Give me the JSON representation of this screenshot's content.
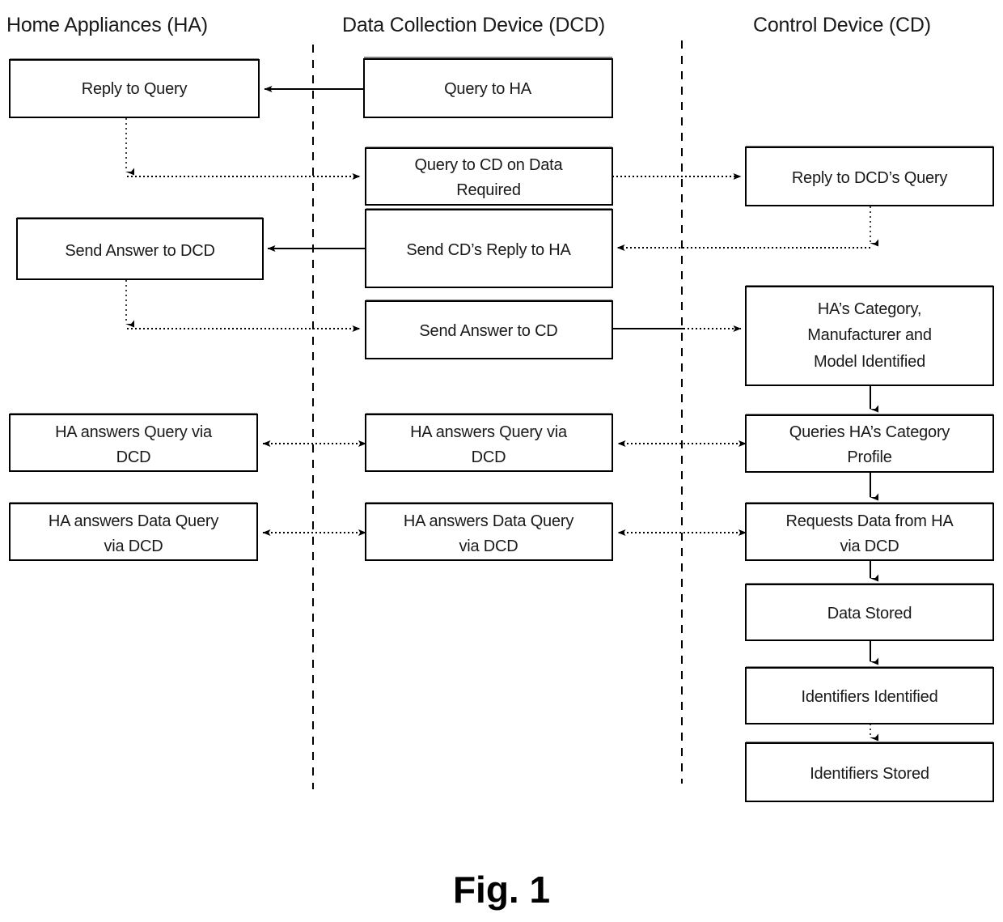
{
  "figure": {
    "caption": "Fig. 1",
    "lanes": [
      {
        "id": "ha",
        "title": "Home Appliances (HA)"
      },
      {
        "id": "dcd",
        "title": "Data Collection Device (DCD)"
      },
      {
        "id": "cd",
        "title": "Control Device (CD)"
      }
    ],
    "nodes": {
      "ha_reply_to_query": "Reply to Query",
      "ha_send_answer_to_dcd": "Send Answer to DCD",
      "ha_answers_query_line1": "HA answers Query via",
      "ha_answers_query_line2": "DCD",
      "ha_answers_data_query_line1": "HA answers Data Query",
      "ha_answers_data_query_line2": "via DCD",
      "dcd_query_to_ha": "Query to HA",
      "dcd_query_to_cd_line1": "Query to CD on Data",
      "dcd_query_to_cd_line2": "Required",
      "dcd_send_cds_reply": "Send CD’s Reply to HA",
      "dcd_send_answer_to_cd": "Send Answer to CD",
      "dcd_answers_query_line1": "HA answers Query via",
      "dcd_answers_query_line2": "DCD",
      "dcd_answers_data_query_line1": "HA answers Data Query",
      "dcd_answers_data_query_line2": "via DCD",
      "cd_reply_to_dcd_query": "Reply to DCD’s Query",
      "cd_category_line1": "HA’s Category,",
      "cd_category_line2": "Manufacturer and",
      "cd_category_line3": "Model Identified",
      "cd_queries_profile_line1": "Queries HA’s Category",
      "cd_queries_profile_line2": "Profile",
      "cd_requests_data_line1": "Requests Data from HA",
      "cd_requests_data_line2": "via DCD",
      "cd_data_stored": "Data Stored",
      "cd_identifiers_identified": "Identifiers Identified",
      "cd_identifiers_stored": "Identifiers Stored"
    },
    "colors": {
      "background": "#ffffff",
      "stroke": "#000000",
      "text": "#1a1a1a",
      "box_fill": "#ffffff",
      "box_shadow": "#808080"
    }
  },
  "chart_data": {
    "type": "diagram",
    "title": "Fig. 1",
    "subtype": "swimlane-flowchart",
    "lanes": [
      "Home Appliances (HA)",
      "Data Collection Device (DCD)",
      "Control Device (CD)"
    ],
    "nodes": [
      {
        "lane": "Home Appliances (HA)",
        "label": "Reply to Query"
      },
      {
        "lane": "Home Appliances (HA)",
        "label": "Send Answer to DCD"
      },
      {
        "lane": "Home Appliances (HA)",
        "label": "HA answers Query via DCD"
      },
      {
        "lane": "Home Appliances (HA)",
        "label": "HA answers Data Query via DCD"
      },
      {
        "lane": "Data Collection Device (DCD)",
        "label": "Query to HA"
      },
      {
        "lane": "Data Collection Device (DCD)",
        "label": "Query to CD on Data Required"
      },
      {
        "lane": "Data Collection Device (DCD)",
        "label": "Send CD’s Reply to HA"
      },
      {
        "lane": "Data Collection Device (DCD)",
        "label": "Send Answer to CD"
      },
      {
        "lane": "Data Collection Device (DCD)",
        "label": "HA answers Query via DCD"
      },
      {
        "lane": "Data Collection Device (DCD)",
        "label": "HA answers Data Query via DCD"
      },
      {
        "lane": "Control Device (CD)",
        "label": "Reply to DCD’s Query"
      },
      {
        "lane": "Control Device (CD)",
        "label": "HA’s Category, Manufacturer and Model Identified"
      },
      {
        "lane": "Control Device (CD)",
        "label": "Queries HA’s Category Profile"
      },
      {
        "lane": "Control Device (CD)",
        "label": "Requests Data from HA via DCD"
      },
      {
        "lane": "Control Device (CD)",
        "label": "Data Stored"
      },
      {
        "lane": "Control Device (CD)",
        "label": "Identifiers Identified"
      },
      {
        "lane": "Control Device (CD)",
        "label": "Identifiers Stored"
      }
    ],
    "edges": [
      {
        "from": "Query to HA",
        "to": "Reply to Query",
        "style": "solid",
        "direction": "one-way"
      },
      {
        "from": "Reply to Query",
        "to": "Query to CD on Data Required",
        "style": "dotted",
        "direction": "one-way"
      },
      {
        "from": "Query to CD on Data Required",
        "to": "Reply to DCD’s Query",
        "style": "dotted",
        "direction": "one-way"
      },
      {
        "from": "Reply to DCD’s Query",
        "to": "Send CD’s Reply to HA",
        "style": "dotted",
        "direction": "one-way"
      },
      {
        "from": "Send CD’s Reply to HA",
        "to": "Send Answer to DCD",
        "style": "solid",
        "direction": "one-way"
      },
      {
        "from": "Send Answer to DCD",
        "to": "Send Answer to CD",
        "style": "dotted",
        "direction": "one-way"
      },
      {
        "from": "Send Answer to CD",
        "to": "HA’s Category, Manufacturer and Model Identified",
        "style": "solid",
        "direction": "one-way"
      },
      {
        "from": "HA’s Category, Manufacturer and Model Identified",
        "to": "Queries HA’s Category Profile",
        "style": "solid",
        "direction": "one-way"
      },
      {
        "from": "Queries HA’s Category Profile",
        "to": "HA answers Query via DCD (DCD lane)",
        "style": "dotted",
        "direction": "two-way"
      },
      {
        "from": "HA answers Query via DCD (DCD lane)",
        "to": "HA answers Query via DCD (HA lane)",
        "style": "dotted",
        "direction": "two-way"
      },
      {
        "from": "Queries HA’s Category Profile",
        "to": "Requests Data from HA via DCD",
        "style": "solid",
        "direction": "one-way"
      },
      {
        "from": "Requests Data from HA via DCD",
        "to": "HA answers Data Query via DCD (DCD lane)",
        "style": "dotted",
        "direction": "two-way"
      },
      {
        "from": "HA answers Data Query via DCD (DCD lane)",
        "to": "HA answers Data Query via DCD (HA lane)",
        "style": "dotted",
        "direction": "two-way"
      },
      {
        "from": "Requests Data from HA via DCD",
        "to": "Data Stored",
        "style": "solid",
        "direction": "one-way"
      },
      {
        "from": "Data Stored",
        "to": "Identifiers Identified",
        "style": "solid",
        "direction": "one-way"
      },
      {
        "from": "Identifiers Identified",
        "to": "Identifiers Stored",
        "style": "solid",
        "direction": "one-way"
      }
    ]
  }
}
